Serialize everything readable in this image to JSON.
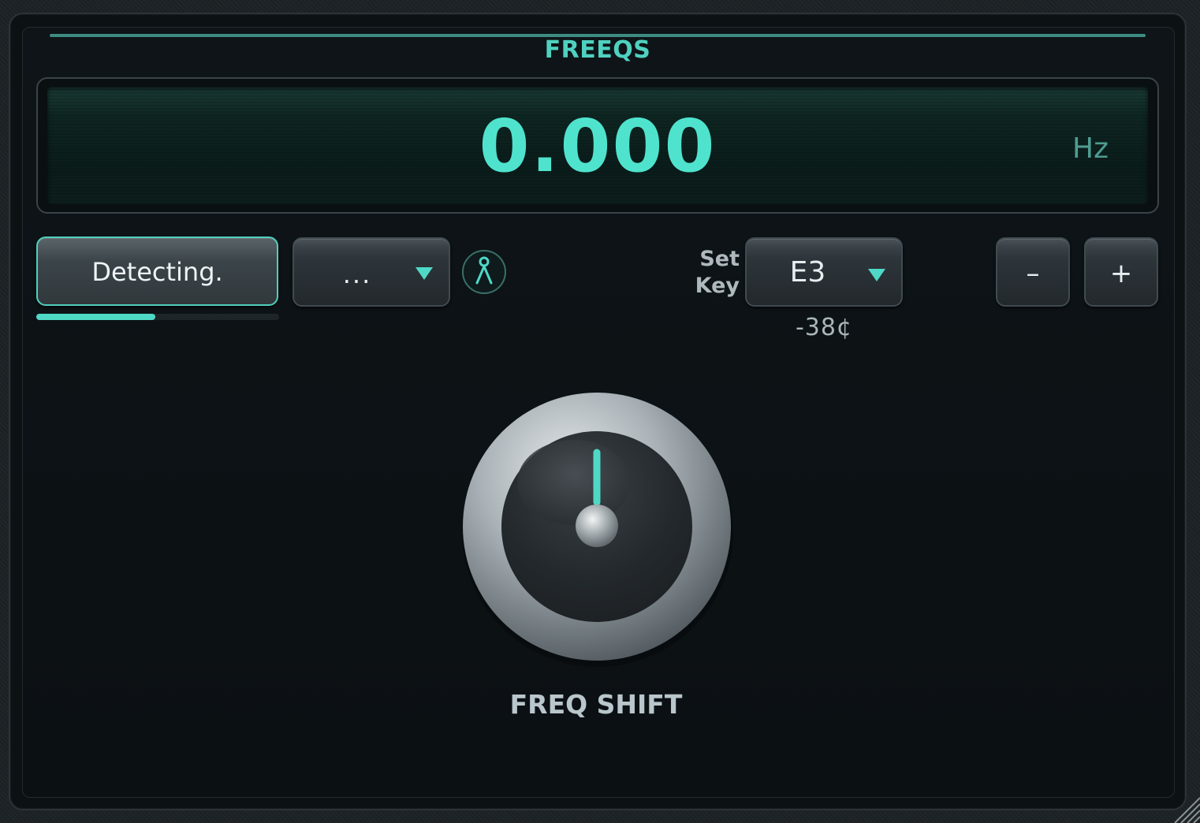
{
  "plugin": {
    "title": "FREEQS"
  },
  "display": {
    "value": "0.000",
    "unit": "Hz"
  },
  "detect": {
    "label": "Detecting.",
    "progress": 0.49
  },
  "mode_dropdown": {
    "value": "..."
  },
  "person_icon": "person-icon",
  "key": {
    "label": "Set Key",
    "value": "E3",
    "cents": "-38¢"
  },
  "steppers": {
    "minus": "–",
    "plus": "+"
  },
  "knob": {
    "label": "FREQ SHIFT",
    "position": 0.5
  },
  "colors": {
    "accent": "#4fd8c6",
    "title": "#4fd1c0",
    "background": "#0c1114"
  }
}
